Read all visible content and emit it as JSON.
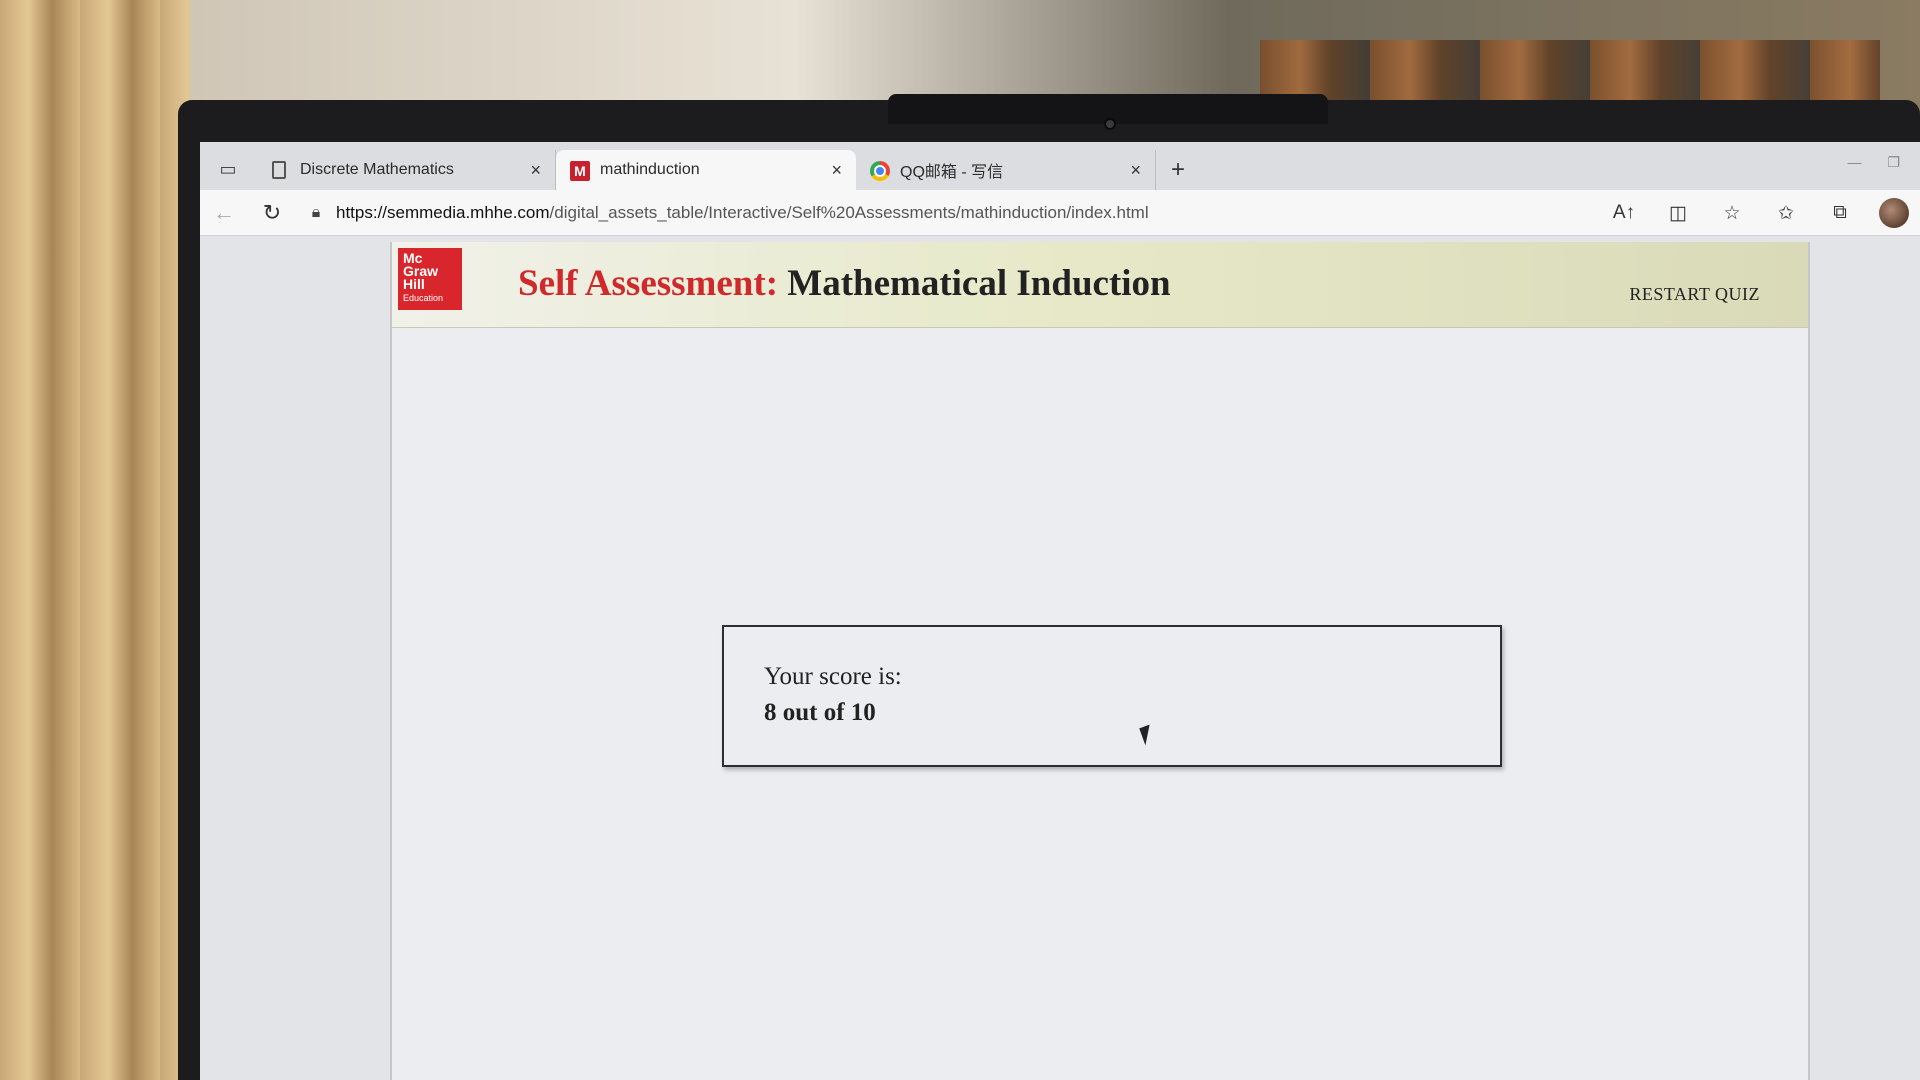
{
  "browser": {
    "tabs": [
      {
        "title": "Discrete Mathematics",
        "favicon": "document-icon",
        "close": "×"
      },
      {
        "title": "mathinduction",
        "favicon": "M",
        "close": "×"
      },
      {
        "title": "QQ邮箱 - 写信",
        "favicon": "chrome-icon",
        "close": "×"
      }
    ],
    "new_tab": "+",
    "url_host": "https://semmedia.mhhe.com",
    "url_path": "/digital_assets_table/Interactive/Self%20Assessments/mathinduction/index.html"
  },
  "logo": {
    "line1": "Mc",
    "line2": "Graw",
    "line3": "Hill",
    "line4": "Education"
  },
  "header": {
    "title_lead": "Self Assessment:",
    "title_rest": "Mathematical Induction",
    "restart_label": "RESTART QUIZ"
  },
  "result": {
    "label": "Your score is:",
    "value": "8 out of 10"
  },
  "colors": {
    "brand_red": "#d9262c",
    "title_red": "#d0292b"
  }
}
